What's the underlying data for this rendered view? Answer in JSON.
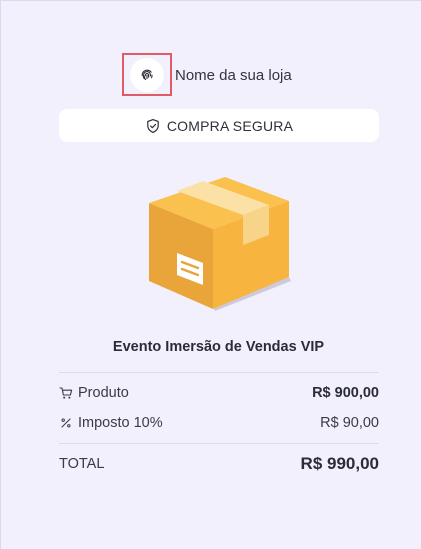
{
  "store": {
    "name": "Nome da sua loja",
    "logo_icon": "fingerprint-icon"
  },
  "badge": {
    "label": "COMPRA SEGURA",
    "icon": "shield-check-icon"
  },
  "product": {
    "image": "package-box-icon",
    "title": "Evento Imersão de Vendas VIP"
  },
  "summary": {
    "rows": [
      {
        "icon": "cart-icon",
        "label": "Produto",
        "value": "R$ 900,00"
      },
      {
        "icon": "percent-icon",
        "label": "Imposto 10%",
        "value": "R$ 90,00"
      }
    ],
    "total_label": "TOTAL",
    "total_value": "R$ 990,00"
  },
  "colors": {
    "background": "#f2f0fc",
    "highlight_border": "#e35a67",
    "box_orange": "#f5b23c",
    "box_tape": "#fbe1a6"
  }
}
